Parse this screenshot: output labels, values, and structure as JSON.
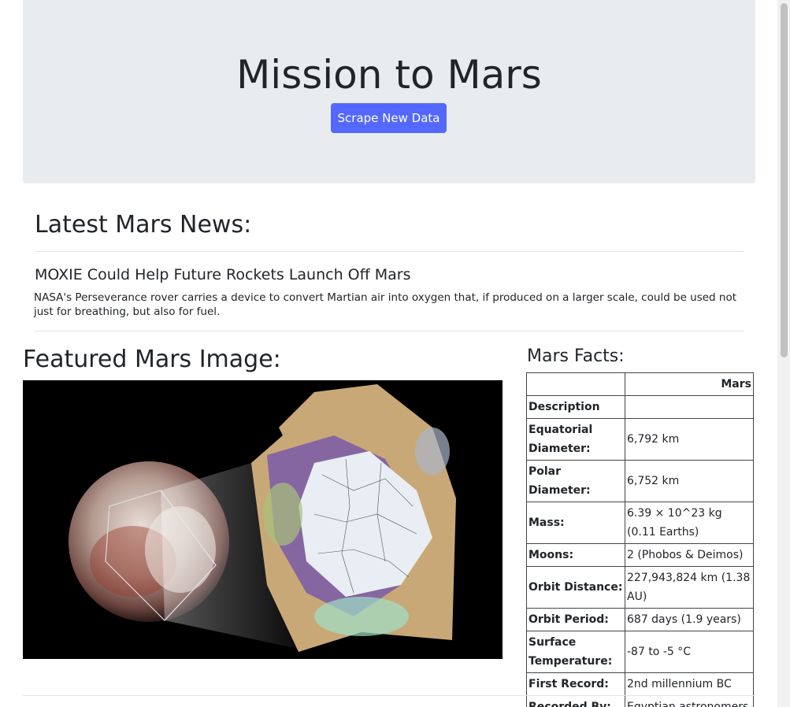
{
  "header": {
    "title": "Mission to Mars",
    "button_label": "Scrape New Data",
    "button_color": "#5468ff"
  },
  "news": {
    "heading": "Latest Mars News:",
    "title": "MOXIE Could Help Future Rockets Launch Off Mars",
    "paragraph": "NASA's Perseverance rover carries a device to convert Martian air into oxygen that, if produced on a larger scale, could be used not just for breathing, but also for fuel."
  },
  "featured": {
    "heading": "Featured Mars Image:"
  },
  "facts": {
    "heading": "Mars Facts:",
    "column_header": "Mars",
    "rows": [
      {
        "label": "Description",
        "value": ""
      },
      {
        "label": "Equatorial Diameter:",
        "value": "6,792 km"
      },
      {
        "label": "Polar Diameter:",
        "value": "6,752 km"
      },
      {
        "label": "Mass:",
        "value": "6.39 × 10^23 kg (0.11 Earths)"
      },
      {
        "label": "Moons:",
        "value": "2 (Phobos & Deimos)"
      },
      {
        "label": "Orbit Distance:",
        "value": "227,943,824 km (1.38 AU)"
      },
      {
        "label": "Orbit Period:",
        "value": "687 days (1.9 years)"
      },
      {
        "label": "Surface Temperature:",
        "value": "-87 to -5 °C"
      },
      {
        "label": "First Record:",
        "value": "2nd millennium BC"
      },
      {
        "label": "Recorded By:",
        "value": "Egyptian astronomers"
      }
    ]
  }
}
